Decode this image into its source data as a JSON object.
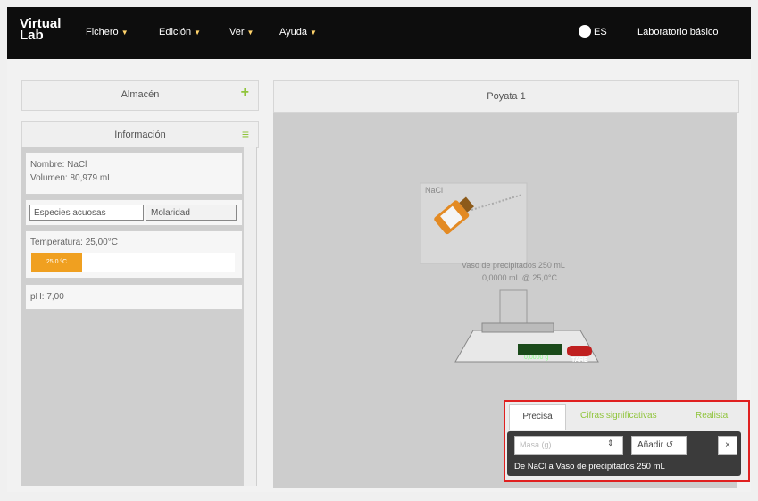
{
  "app": {
    "logo_line1": "Virtual",
    "logo_line2": "Lab"
  },
  "menu": [
    {
      "label": "Fichero"
    },
    {
      "label": "Edición"
    },
    {
      "label": "Ver"
    },
    {
      "label": "Ayuda"
    }
  ],
  "lang": "ES",
  "lab_name": "Laboratorio básico",
  "left": {
    "almacen": "Almacén",
    "informacion": "Información",
    "nombre": "Nombre: NaCl",
    "volumen": "Volumen: 80,979 mL",
    "especies": "Especies acuosas",
    "molaridad": "Molaridad",
    "temperatura": "Temperatura: 25,00°C",
    "temp_button": "25,0 ºC",
    "ph": "pH: 7,00"
  },
  "bench": {
    "title": "Poyata 1",
    "bottle_label": "NaCl",
    "vessel_label": "Vaso de precipitados 250 mL",
    "vessel_sub": "0,0000 mL @ 25,0°C",
    "scale_reading": "0,0000 g",
    "tare": "TARE"
  },
  "popup": {
    "tabs": [
      "Precisa",
      "Cifras significativas",
      "Realista"
    ],
    "input_placeholder": "Masa (g)",
    "add_label": "Añadir",
    "close_label": "×",
    "description": "De NaCl a Vaso de precipitados 250 mL"
  },
  "colors": {
    "accent": "#8fc43a",
    "temp": "#f0a020",
    "highlight": "#e02020"
  }
}
